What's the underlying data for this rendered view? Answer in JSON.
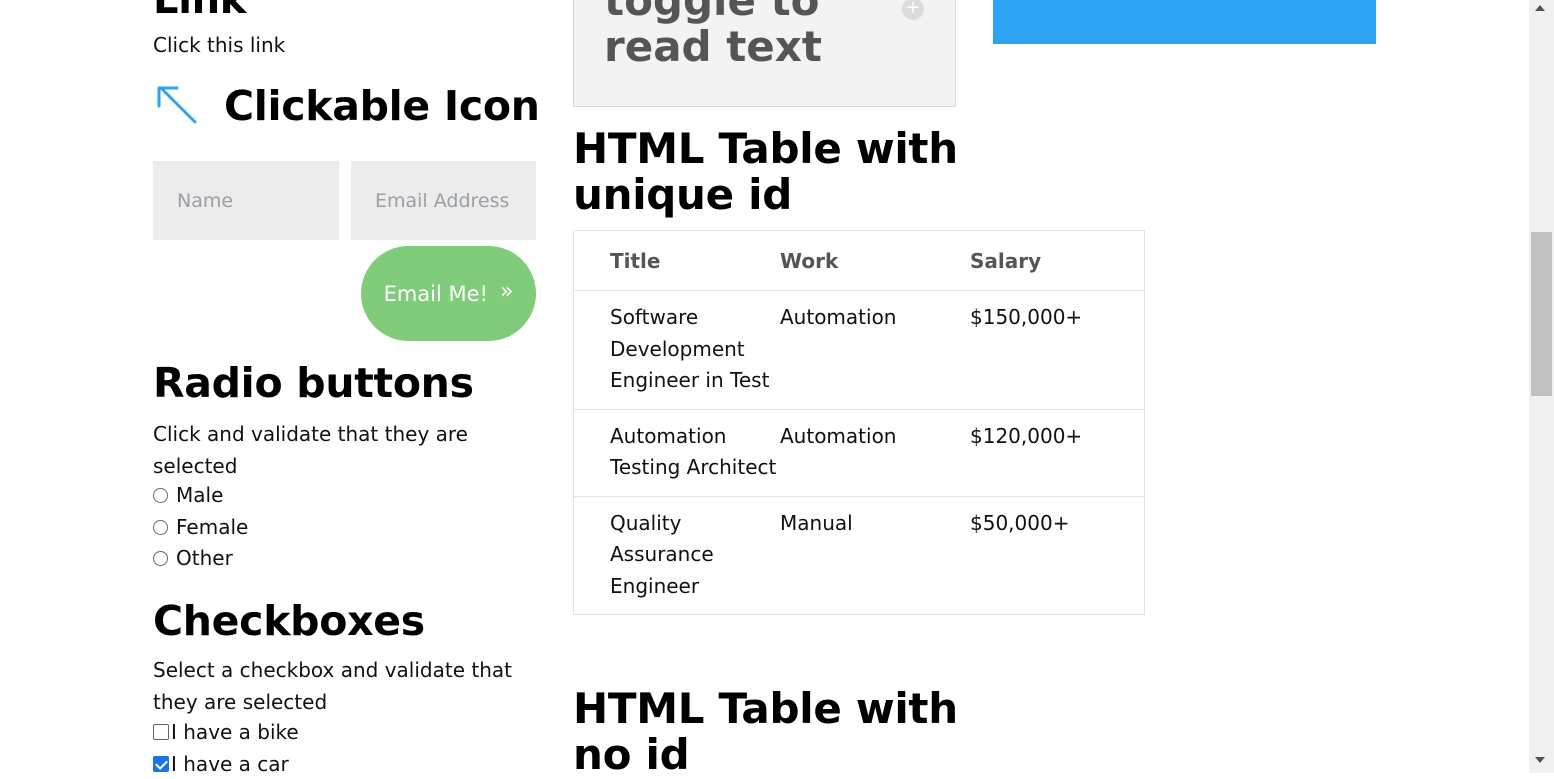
{
  "link_section": {
    "heading": "Link",
    "link_text": "Click this link"
  },
  "clickable_icon": {
    "icon": "arrow-up-left-icon",
    "heading": "Clickable Icon"
  },
  "contact_form": {
    "name_placeholder": "Name",
    "email_placeholder": "Email Address",
    "submit_label": "Email Me!",
    "submit_glyph": "»"
  },
  "radio_section": {
    "heading": "Radio buttons",
    "description": "Click and validate that they are selected",
    "options": [
      {
        "label": "Male",
        "selected": false
      },
      {
        "label": "Female",
        "selected": false
      },
      {
        "label": "Other",
        "selected": false
      }
    ]
  },
  "checkbox_section": {
    "heading": "Checkboxes",
    "description": "Select a checkbox and validate that they are selected",
    "options": [
      {
        "label": "I have a bike",
        "checked": false
      },
      {
        "label": "I have a car",
        "checked": true
      }
    ]
  },
  "toggle_section": {
    "text": "toggle to read text",
    "toggle_icon": "plus-circle-icon"
  },
  "table_unique_id": {
    "heading": "HTML Table with unique id",
    "columns": [
      "Title",
      "Work",
      "Salary"
    ],
    "rows": [
      [
        "Software Development Engineer in Test",
        "Automation",
        "$150,000+"
      ],
      [
        "Automation Testing Architect",
        "Automation",
        "$120,000+"
      ],
      [
        "Quality Assurance Engineer",
        "Manual",
        "$50,000+"
      ]
    ]
  },
  "table_no_id": {
    "heading": "HTML Table with no id"
  },
  "colors": {
    "accent_blue": "#2ea3f2",
    "button_green": "#80cc7a",
    "field_bg": "#ececec"
  }
}
